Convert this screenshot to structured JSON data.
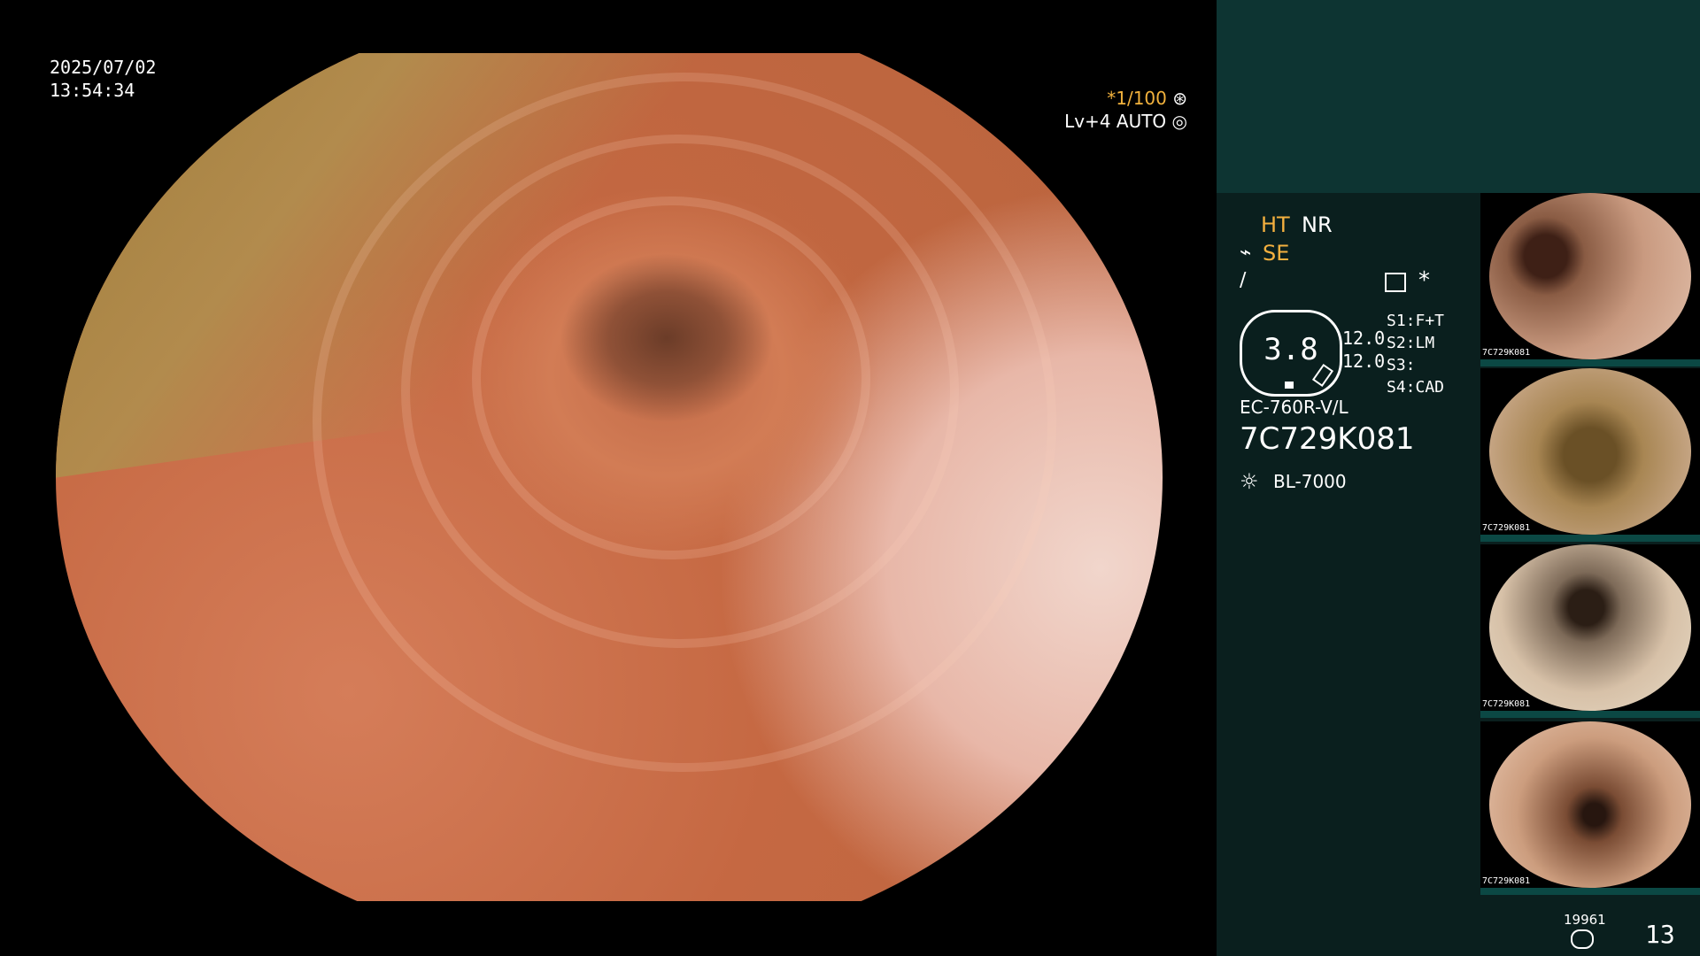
{
  "view": {
    "date": "2025/07/02",
    "time": "13:54:34",
    "shutter_speed": "*1/100",
    "level_mode": "Lv+4 AUTO"
  },
  "panel": {
    "ht": "HT",
    "nr": "NR",
    "se": "SE",
    "value_main": "3.8",
    "value_1": "12.0",
    "value_2": "12.0",
    "s1": "S1:F+T",
    "s2": "S2:LM",
    "s3": "S3:",
    "s4": "S4:CAD",
    "model": "EC-760R-V/L",
    "serial": "7C729K081",
    "light": "BL-7000",
    "bottom_small": "19961",
    "bottom_num": "13"
  },
  "thumbnails": {
    "label": "7C729K081"
  },
  "icons": {
    "shutter": "gear-icon",
    "auto": "circle-target-icon",
    "se": "scissors-icon",
    "f": "waveform-icon",
    "menu": "menu-icon",
    "star": "asterisk-icon",
    "light": "sun-icon",
    "database": "database-icon"
  }
}
